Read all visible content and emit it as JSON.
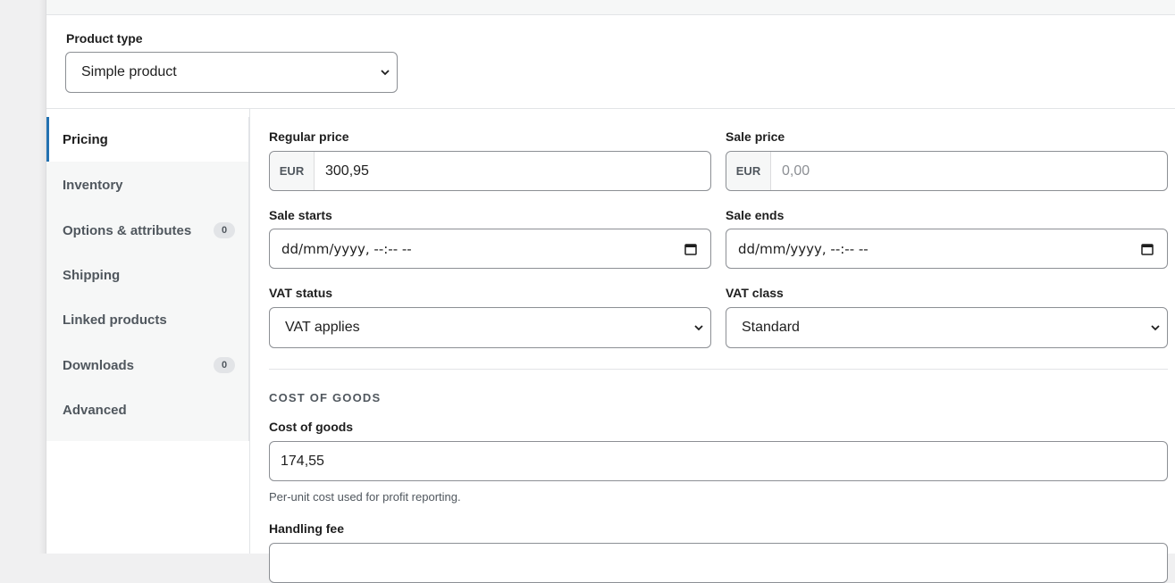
{
  "product_type": {
    "label": "Product type",
    "selected": "Simple product"
  },
  "tabs": [
    {
      "label": "Pricing",
      "active": true
    },
    {
      "label": "Inventory"
    },
    {
      "label": "Options & attributes",
      "badge": "0"
    },
    {
      "label": "Shipping"
    },
    {
      "label": "Linked products"
    },
    {
      "label": "Downloads",
      "badge": "0"
    },
    {
      "label": "Advanced"
    }
  ],
  "pricing": {
    "regular_price": {
      "label": "Regular price",
      "currency": "EUR",
      "value": "300,95"
    },
    "sale_price": {
      "label": "Sale price",
      "currency": "EUR",
      "placeholder": "0,00"
    },
    "sale_starts": {
      "label": "Sale starts",
      "value": "dd/mm/yyyy, --:-- --"
    },
    "sale_ends": {
      "label": "Sale ends",
      "value": "dd/mm/yyyy, --:-- --"
    },
    "vat_status": {
      "label": "VAT status",
      "selected": "VAT applies"
    },
    "vat_class": {
      "label": "VAT class",
      "selected": "Standard"
    }
  },
  "cost_of_goods": {
    "heading": "COST OF GOODS",
    "field": {
      "label": "Cost of goods",
      "value": "174,55",
      "help": "Per-unit cost used for profit reporting."
    },
    "handling_fee": {
      "label": "Handling fee"
    }
  }
}
